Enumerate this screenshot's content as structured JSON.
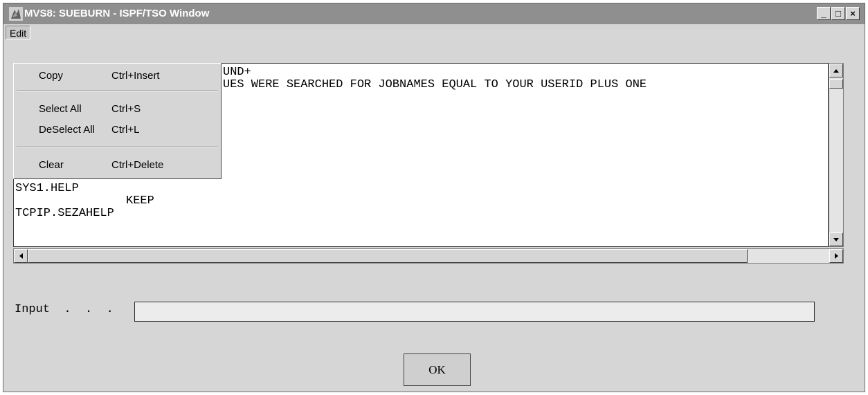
{
  "window": {
    "title": "MVS8: SUEBURN - ISPF/TSO Window",
    "controls": {
      "minimize": "_",
      "maximize": "□",
      "close": "×"
    }
  },
  "menubar": {
    "edit_label": "Edit"
  },
  "edit_menu": {
    "items": [
      {
        "label": "Copy",
        "shortcut": "Ctrl+Insert"
      },
      {
        "label": "Select All",
        "shortcut": "Ctrl+S"
      },
      {
        "label": "DeSelect All",
        "shortcut": "Ctrl+L"
      },
      {
        "label": "Clear",
        "shortcut": "Ctrl+Delete"
      }
    ]
  },
  "output": {
    "lines": [
      "UND+",
      "UES WERE SEARCHED FOR JOBNAMES EQUAL TO YOUR USERID PLUS ONE",
      "SYS1.HELP",
      "KEEP",
      "TCPIP.SEZAHELP"
    ]
  },
  "input": {
    "label": "Input  .  .  .",
    "value": ""
  },
  "ok_button": {
    "label": "OK"
  }
}
